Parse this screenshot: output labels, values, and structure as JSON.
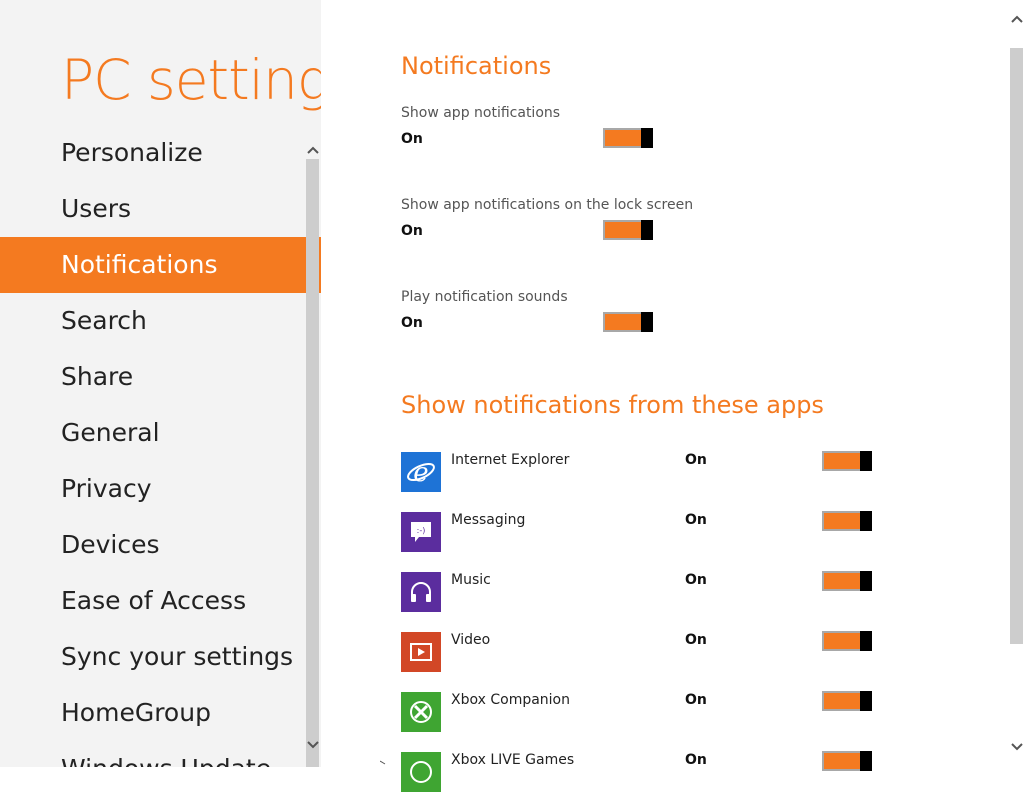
{
  "app_title": "PC settings",
  "nav": {
    "items": [
      {
        "label": "Personalize"
      },
      {
        "label": "Users"
      },
      {
        "label": "Notifications",
        "selected": true
      },
      {
        "label": "Search"
      },
      {
        "label": "Share"
      },
      {
        "label": "General"
      },
      {
        "label": "Privacy"
      },
      {
        "label": "Devices"
      },
      {
        "label": "Ease of Access"
      },
      {
        "label": "Sync your settings"
      },
      {
        "label": "HomeGroup"
      },
      {
        "label": "Windows Update"
      }
    ]
  },
  "notifications": {
    "heading": "Notifications",
    "settings": [
      {
        "label": "Show app notifications",
        "state": "On"
      },
      {
        "label": "Show app notifications on the lock screen",
        "state": "On"
      },
      {
        "label": "Play notification sounds",
        "state": "On"
      }
    ]
  },
  "apps_section": {
    "heading": "Show notifications from these apps",
    "apps": [
      {
        "name": "Internet Explorer",
        "state": "On",
        "icon": "internet-explorer-icon",
        "color": "#1e73d6"
      },
      {
        "name": "Messaging",
        "state": "On",
        "icon": "messaging-icon",
        "color": "#5b2d9e"
      },
      {
        "name": "Music",
        "state": "On",
        "icon": "headphones-icon",
        "color": "#5b2d9e"
      },
      {
        "name": "Video",
        "state": "On",
        "icon": "video-play-icon",
        "color": "#d24726"
      },
      {
        "name": "Xbox Companion",
        "state": "On",
        "icon": "xbox-icon",
        "color": "#3fa532"
      },
      {
        "name": "Xbox LIVE Games",
        "state": "On",
        "icon": "xbox-games-icon",
        "color": "#3fa532"
      }
    ]
  },
  "colors": {
    "accent": "#f47a20",
    "toggle_knob": "#000000",
    "left_pane_bg": "#f3f3f3"
  }
}
